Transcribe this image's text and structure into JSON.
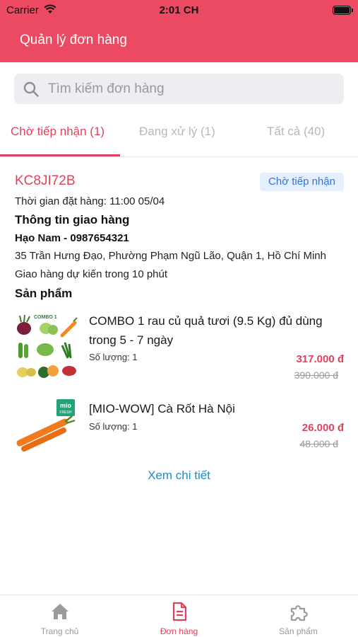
{
  "status_bar": {
    "carrier": "Carrier",
    "time": "2:01 CH"
  },
  "header": {
    "title": "Quản lý đơn hàng"
  },
  "search": {
    "placeholder": "Tìm kiếm đơn hàng",
    "icon": "search-icon"
  },
  "tabs": [
    {
      "label": "Chờ tiếp nhận (1)",
      "active": true
    },
    {
      "label": "Đang xử lý (1)",
      "active": false
    },
    {
      "label": "Tất cả (40)",
      "active": false
    }
  ],
  "order": {
    "code": "KC8JI72B",
    "status": "Chờ tiếp nhận",
    "order_time": "Thời gian đặt hàng: 11:00 05/04",
    "shipping_title": "Thông tin giao hàng",
    "recipient": "Hạo Nam - 0987654321",
    "address": "35 Trần Hưng Đạo, Phường Phạm Ngũ Lão,  Quận 1, Hồ Chí Minh",
    "eta": "Giao hàng dự kiến trong 10 phút",
    "products_title": "Sản phẩm",
    "products": [
      {
        "name": "COMBO 1 rau củ quả tươi (9.5 Kg) đủ dùng trong 5 - 7 ngày",
        "quantity": "Số lượng: 1",
        "price": "317.000 đ",
        "old_price": "390.000 đ",
        "thumb_label": "COMBO 1"
      },
      {
        "name": "[MIO-WOW] Cà Rốt Hà Nội",
        "quantity": "Số lượng: 1",
        "price": "26.000 đ",
        "old_price": "48.000 đ",
        "thumb_label": "mio"
      }
    ],
    "detail_link": "Xem chi tiết"
  },
  "bottom_nav": [
    {
      "label": "Trang chủ",
      "icon": "home-icon",
      "active": false
    },
    {
      "label": "Đơn hàng",
      "icon": "document-icon",
      "active": true
    },
    {
      "label": "Sản phẩm",
      "icon": "puzzle-icon",
      "active": false
    }
  ],
  "colors": {
    "brand": "#ec4a63",
    "accent": "#e0415c",
    "link": "#1d8bd0",
    "badge_text": "#2f76db",
    "badge_bg": "#e5effd"
  }
}
